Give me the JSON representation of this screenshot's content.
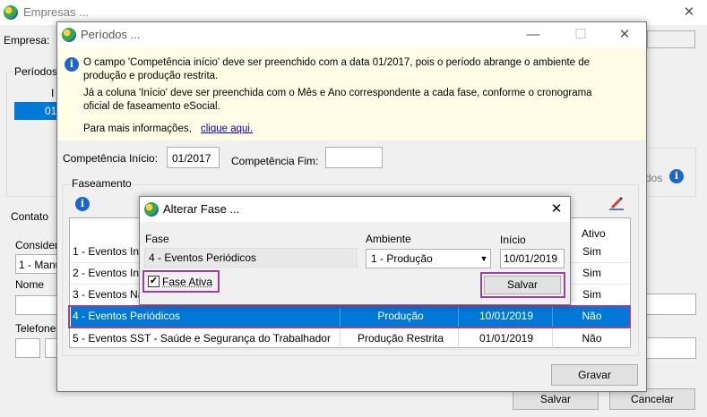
{
  "empresas": {
    "title": "Empresas ...",
    "empresa_label": "Empresa:",
    "periodos_label": "Períodos",
    "col_i": "I",
    "row_value": "01",
    "contato_label": "Contato",
    "consider_label": "Consider",
    "consider_value": "1 - Manu",
    "nome_label": "Nome",
    "telefone_label": "Telefone",
    "dos_text": "dos",
    "salvar": "Salvar",
    "cancelar": "Cancelar"
  },
  "periodos": {
    "title": "Períodos ...",
    "info_line1": "O campo 'Competência início' deve ser preenchido com a data 01/2017, pois o período abrange o ambiente de",
    "info_line2": "produção e produção restrita.",
    "info_line3": "Já a coluna 'Início' deve ser preenchida com o Mês e Ano correspondente a cada fase, conforme o cronograma",
    "info_line4": "oficial de faseamento eSocial.",
    "info_more": "Para mais informações,",
    "info_link": "clique aqui.",
    "competencia_inicio_label": "Competência Início:",
    "competencia_inicio_value": "01/2017",
    "competencia_fim_label": "Competência Fim:",
    "competencia_fim_value": "",
    "faseamento_label": "Faseamento",
    "ativo_header": "Ativo",
    "gravar": "Gravar",
    "rows": [
      {
        "fase": "1 - Eventos Ini",
        "ambiente": "",
        "inicio": "",
        "ativo": "Sim"
      },
      {
        "fase": "2 - Eventos Ini",
        "ambiente": "",
        "inicio": "",
        "ativo": "Sim"
      },
      {
        "fase": "3 - Eventos Nã",
        "ambiente": "",
        "inicio": "",
        "ativo": "Sim"
      },
      {
        "fase": "4 - Eventos Periódicos",
        "ambiente": "Produção",
        "inicio": "10/01/2019",
        "ativo": "Não"
      },
      {
        "fase": "5 - Eventos SST  - Saúde e Segurança do Trabalhador",
        "ambiente": "Produção Restrita",
        "inicio": "01/01/2019",
        "ativo": "Não"
      }
    ]
  },
  "alterar": {
    "title": "Alterar Fase ...",
    "fase_label": "Fase",
    "fase_value": "4 - Eventos Periódicos",
    "ambiente_label": "Ambiente",
    "ambiente_value": "1 - Produção",
    "inicio_label": "Início",
    "inicio_value": "10/01/2019",
    "fase_ativa_label": "Fase Ativa",
    "salvar": "Salvar"
  },
  "colors": {
    "selection": "#0078d7",
    "highlight": "#9b3fa0",
    "info_bg": "#fffde6"
  }
}
